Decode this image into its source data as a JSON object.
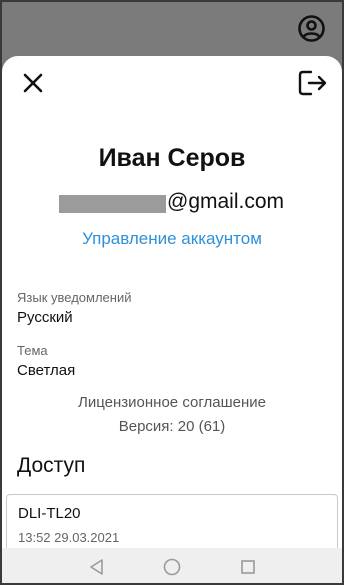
{
  "profile": {
    "name": "Иван Серов",
    "email_domain": "@gmail.com",
    "manage_account": "Управление аккаунтом"
  },
  "settings": {
    "language_label": "Язык уведомлений",
    "language_value": "Русский",
    "theme_label": "Тема",
    "theme_value": "Светлая"
  },
  "info": {
    "license": "Лицензионное соглашение",
    "version": "Версия: 20 (61)"
  },
  "access": {
    "title": "Доступ",
    "devices": [
      {
        "name": "DLI-TL20",
        "time": "13:52 29.03.2021"
      }
    ]
  },
  "icons": {
    "account": "account-circle-icon",
    "close": "close-icon",
    "logout": "logout-icon",
    "back": "back-triangle-icon",
    "home": "home-circle-icon",
    "recents": "recents-square-icon"
  },
  "colors": {
    "accent": "#2f8fd8",
    "backdrop": "#7b7b7b",
    "sheet": "#ffffff"
  }
}
